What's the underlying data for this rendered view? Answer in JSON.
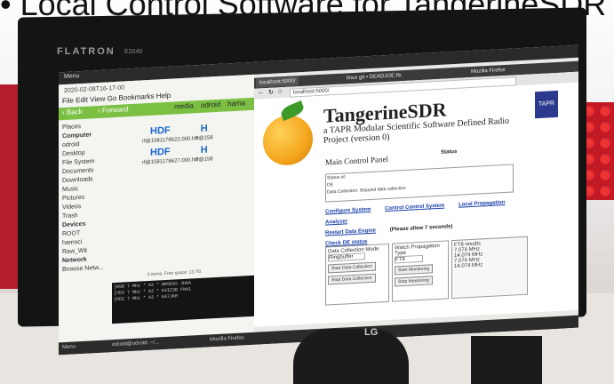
{
  "slide_title": "• Local Control Software for TangerineSDR",
  "monitor": {
    "brand": "FLATRON",
    "model": "E2040",
    "maker": "LG"
  },
  "desktop": {
    "topbar_menu": "Menu",
    "file_manager": {
      "title": "2020-02-08T16-17-00",
      "menus": [
        "File",
        "Edit",
        "View",
        "Go",
        "Bookmarks",
        "Help"
      ],
      "back_label": "Back",
      "forward_label": "Forward",
      "path": [
        "media",
        "odroid",
        "hama"
      ],
      "places_label": "Places",
      "sidebar": [
        "Computer",
        "odroid",
        "Desktop",
        "File System",
        "Documents",
        "Downloads",
        "Music",
        "Pictures",
        "Videos",
        "Trash",
        "Devices",
        "ROOT",
        "hamsci",
        "Raw_Wit",
        "Network",
        "Browse Netw..."
      ],
      "files": [
        {
          "icon": "HDF",
          "name": "rf@1581178622.000.h5"
        },
        {
          "icon": "H",
          "name": "rf@158"
        },
        {
          "icon": "HDF",
          "name": "rf@1581178627.000.h5"
        },
        {
          "icon": "H",
          "name": "rf@158"
        }
      ],
      "status": "6 items, Free space: 13.7G"
    },
    "terminal_lines": [
      "[WSB  7 MHz  * A2 * WR9EAS  JH8A",
      "[VE6  7 MHz  * A2 * K4IZ3B  FN41",
      "[KD2  7 MHz  * A3 * KA7JKR"
    ]
  },
  "browser": {
    "app": "Mozilla Firefox",
    "tabs": [
      "localhost:5000/",
      "linux git • DEADJOE.flx"
    ],
    "url": "localhost:5000/",
    "page": {
      "title": "TangerineSDR",
      "subtitle": "a TAPR Modular Scientific Software Defined Radio Project (version 0)",
      "logo_text": "TAPR",
      "main_control_panel": "Main Control Panel",
      "status_label": "Status",
      "status_of": "Status of:",
      "de_label": "DE",
      "data_collection_label": "Data Collection:",
      "data_collection_value": "Stopped data collection",
      "links": [
        "Configure System",
        "Control Control System",
        "Local Propagation Analyzer"
      ],
      "restart_label": "Restart Data Engine",
      "restart_note": "(Please allow 7 seconds)",
      "check_de": "Check DE status",
      "panels": [
        {
          "title": "Data Collection Mode",
          "value": "Ringbuffer",
          "buttons": [
            "Start Data Collection",
            "Stop Data Collection"
          ]
        },
        {
          "title": "Watch Propagation",
          "type_label": "Type",
          "value": "FT8",
          "buttons": [
            "Start Monitoring",
            "Stop Monitoring"
          ]
        },
        {
          "title": "FT8 results",
          "lines": [
            "7.074 MHz",
            "14.074 MHz",
            "7.074 MHz",
            "14.074 MHz"
          ]
        }
      ]
    }
  },
  "taskbar": {
    "items": [
      "Menu",
      "odroid@odroid: ~/...",
      "Mozilla Firefox"
    ]
  }
}
